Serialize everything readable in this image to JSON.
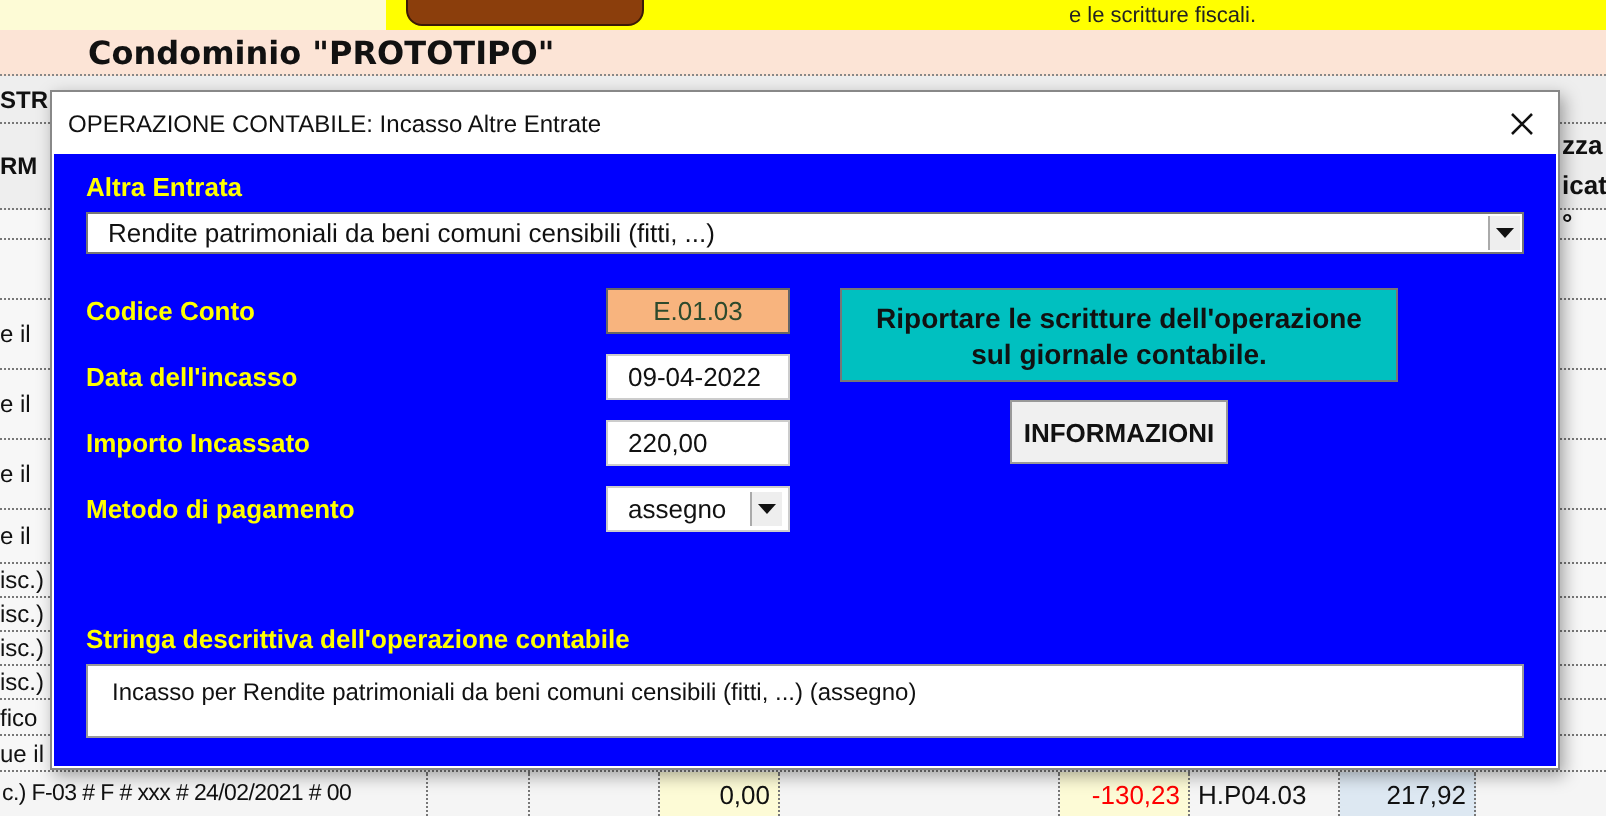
{
  "sheet": {
    "banner_text": "e le scritture fiscali.",
    "title": "Condominio \"PROTOTIPO\"",
    "rows": [
      {
        "kind": "header",
        "left": "STR",
        "right": ""
      },
      {
        "kind": "header",
        "left": "RM",
        "right": "zza\nicat"
      },
      {
        "kind": "plain",
        "left": "",
        "right": "°"
      },
      {
        "kind": "plain",
        "left": "",
        "right": ""
      },
      {
        "kind": "plain",
        "left": "e il",
        "right": ""
      },
      {
        "kind": "plain",
        "left": "e il",
        "right": ""
      },
      {
        "kind": "plain",
        "left": "e il",
        "right": ""
      },
      {
        "kind": "plain",
        "left": "e il",
        "right": ""
      },
      {
        "kind": "plain",
        "left": "isc.)",
        "right": ""
      },
      {
        "kind": "plain",
        "left": "isc.)",
        "right": ""
      },
      {
        "kind": "plain",
        "left": "isc.)",
        "right": ""
      },
      {
        "kind": "plain",
        "left": "isc.)",
        "right": ""
      },
      {
        "kind": "plain",
        "left": "fico",
        "right": ""
      },
      {
        "kind": "plain",
        "left": "ue il",
        "right": ""
      }
    ],
    "last_row": {
      "description": "c.) F-03 # F #  xxx  # 24/02/2021 # 00",
      "amount": "0,00",
      "balance": "-130,23",
      "account": "H.P04.03",
      "total": "217,92"
    }
  },
  "dialog": {
    "title": "OPERAZIONE CONTABILE: Incasso Altre Entrate",
    "entry_label": "Altra Entrata",
    "entry_value": "Rendite patrimoniali da beni comuni censibili (fitti, ...)",
    "fields": [
      {
        "kind": "readonly",
        "label": "Codice Conto",
        "value": "E.01.03"
      },
      {
        "kind": "text",
        "label": "Data dell'incasso",
        "value": "09-04-2022"
      },
      {
        "kind": "text",
        "label": "Importo Incassato",
        "value": "220,00"
      },
      {
        "kind": "select",
        "label": "Metodo di pagamento",
        "value": "assegno"
      }
    ],
    "post_button": "Riportare le scritture dell'operazione sul giornale contabile.",
    "info_button": "INFORMAZIONI",
    "description_label": "Stringa descrittiva dell'operazione contabile",
    "description": "Incasso per Rendite patrimoniali da beni comuni censibili (fitti, ...) (assegno)"
  }
}
